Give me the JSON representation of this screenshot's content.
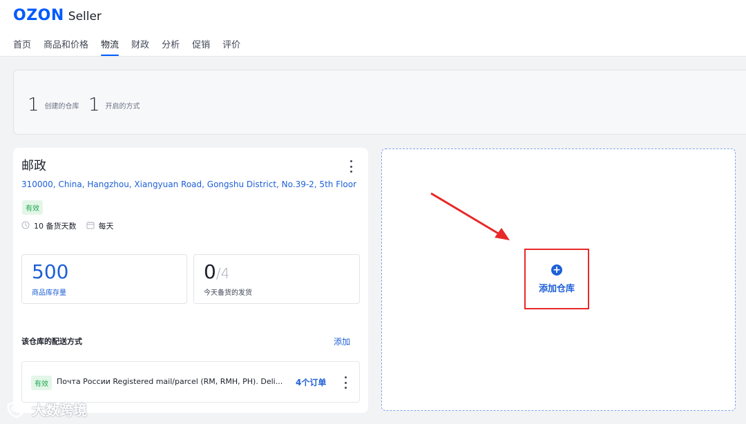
{
  "brand": {
    "ozon": "OZON",
    "seller": "Seller"
  },
  "nav": [
    {
      "label": "首页",
      "active": false
    },
    {
      "label": "商品和价格",
      "active": false
    },
    {
      "label": "物流",
      "active": true
    },
    {
      "label": "财政",
      "active": false
    },
    {
      "label": "分析",
      "active": false
    },
    {
      "label": "促销",
      "active": false
    },
    {
      "label": "评价",
      "active": false
    }
  ],
  "summary": {
    "warehouses_count": "1",
    "warehouses_label": "创建的仓库",
    "methods_count": "1",
    "methods_label": "开启的方式"
  },
  "warehouse": {
    "name": "邮政",
    "address": "310000, China, Hangzhou, Xiangyuan Road, Gongshu District, No.39-2, 5th Floor",
    "status": "有效",
    "prep_days": "10 备货天数",
    "schedule": "每天",
    "stock_value": "500",
    "stock_label": "商品库存量",
    "shipped_value": "0",
    "shipped_total": "/4",
    "shipped_label": "今天备货的发货",
    "shipping_title": "该仓库的配送方式",
    "shipping_add": "添加",
    "method": {
      "status": "有效",
      "name": "Почта России Registered mail/parcel (RM, RMH, PH). Deli...",
      "orders": "4个订单"
    }
  },
  "add_warehouse": {
    "label": "添加仓库",
    "icon": "plus-circle-icon"
  },
  "watermark": {
    "text": "大数跨境"
  },
  "colors": {
    "brand_blue": "#005bff",
    "link_blue": "#1e5fd6",
    "status_green": "#1ea84e",
    "highlight_red": "#e82828"
  }
}
